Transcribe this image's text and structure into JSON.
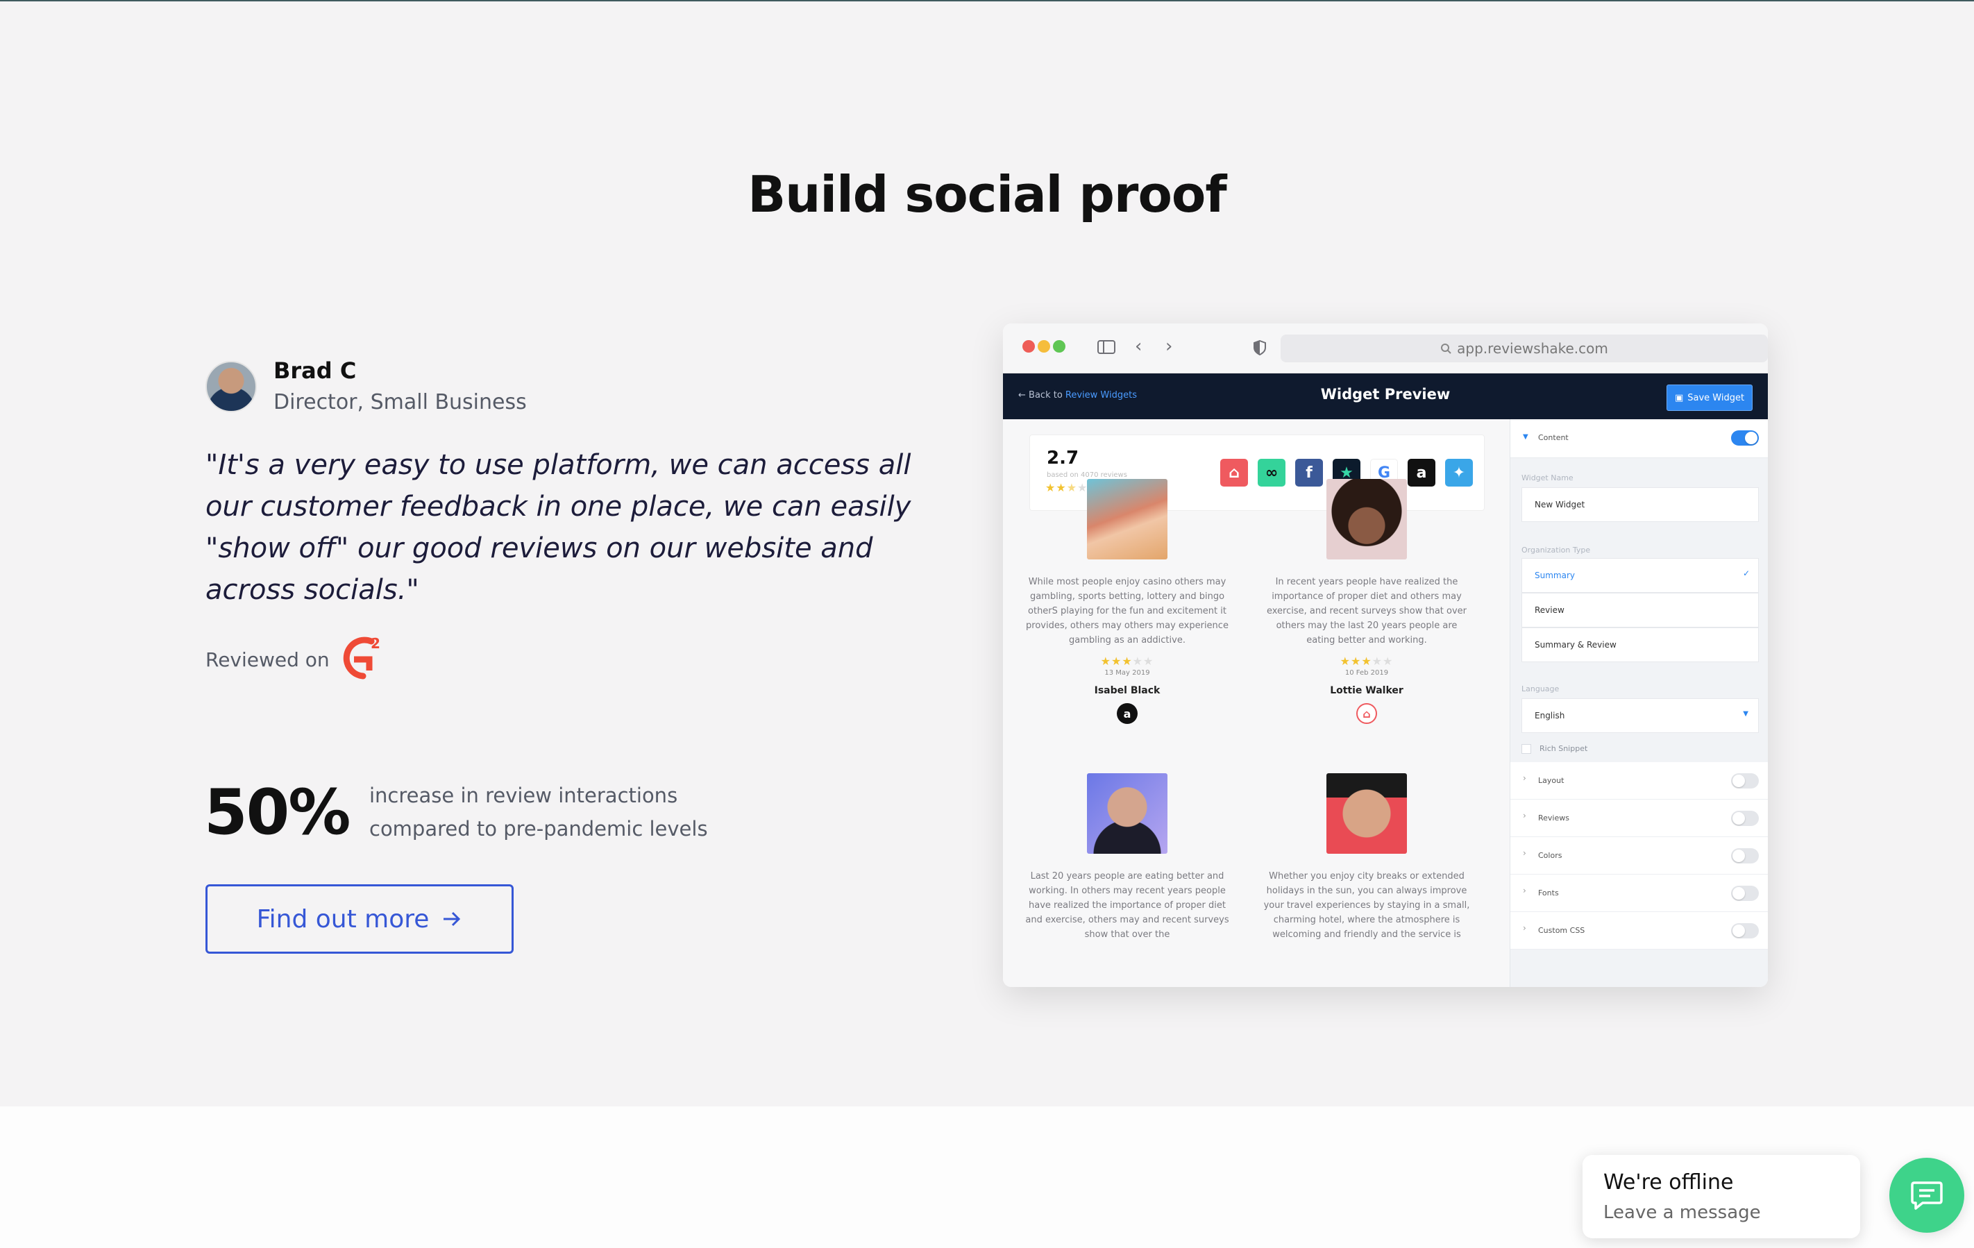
{
  "section": {
    "headline": "Build social proof"
  },
  "testimonial": {
    "name": "Brad C",
    "role": "Director, Small Business",
    "quote": "\"It's a very easy to use platform, we can access all our customer feedback in one place, we can easily \"show off\" our good reviews on our website and across socials.\"",
    "reviewed_on": "Reviewed on",
    "platform_logo": "g2-logo"
  },
  "stat": {
    "value": "50%",
    "line1": "increase in review interactions",
    "line2": "compared to pre-pandemic levels"
  },
  "cta": {
    "label": "Find out more",
    "icon": "arrow-right-icon",
    "color": "#3657d6"
  },
  "mockup": {
    "url": "app.reviewshake.com",
    "back_prefix": "Back to",
    "back_link": "Review Widgets",
    "title": "Widget Preview",
    "save_label": "Save Widget",
    "summary": {
      "rating": "2.7",
      "based_on": "based on 4070 reviews",
      "stars": 2.5,
      "sources": [
        "airbnb",
        "tripadvisor",
        "facebook",
        "trustpilot",
        "google",
        "amazon",
        "twitter"
      ]
    },
    "reviews": [
      {
        "text": "While most people enjoy casino others may gambling, sports betting, lottery and bingo otherS playing for the fun and excitement it provides, others may others may experience gambling as an addictive.",
        "stars": 3,
        "date": "13 May 2019",
        "name": "Isabel Black",
        "source": "amazon"
      },
      {
        "text": "In recent years people have realized the importance of proper diet and others may exercise, and recent surveys show that over others may the last 20 years people are eating better and working.",
        "stars": 3,
        "date": "10 Feb 2019",
        "name": "Lottie Walker",
        "source": "airbnb"
      },
      {
        "text": "Last 20 years people are eating better and working. In others may recent years people have realized the importance of proper diet and exercise, others may and recent surveys show that over the",
        "stars": 0,
        "date": "",
        "name": "",
        "source": ""
      },
      {
        "text": "Whether you enjoy city breaks or extended holidays in the sun, you can always improve your travel experiences by staying in a small, charming hotel, where the atmosphere is welcoming and friendly and the service is",
        "stars": 0,
        "date": "",
        "name": "",
        "source": ""
      }
    ],
    "settings": {
      "content_label": "Content",
      "widget_name_label": "Widget Name",
      "widget_name_value": "New Widget",
      "org_type_label": "Organization Type",
      "org_types": [
        "Summary",
        "Review",
        "Summary & Review"
      ],
      "org_selected": "Summary",
      "language_label": "Language",
      "language_value": "English",
      "rich_snippet": "Rich Snippet",
      "sections": [
        "Layout",
        "Reviews",
        "Colors",
        "Fonts",
        "Custom CSS"
      ]
    }
  },
  "chat": {
    "title": "We're offline",
    "subtitle": "Leave a message",
    "color": "#3ed38a"
  }
}
